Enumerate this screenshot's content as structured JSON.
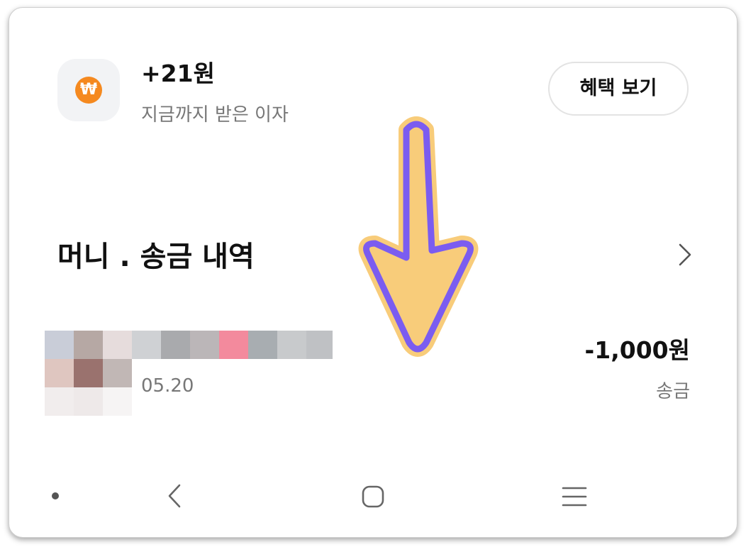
{
  "interest": {
    "amount": "+21원",
    "label": "지금까지 받은 이자",
    "icon": "won-coin-icon",
    "coin_symbol": "₩",
    "coin_color": "#f5891f"
  },
  "benefit_button": {
    "label": "혜택 보기"
  },
  "history_section": {
    "title": "머니 . 송금 내역",
    "chevron_icon": "chevron-right-icon"
  },
  "transaction": {
    "date": "05.20",
    "amount": "-1,000원",
    "type": "송금"
  },
  "annotation": {
    "icon": "arrow-down-icon",
    "fill_color": "#f8cc7a",
    "stroke_color": "#7b5cf0"
  },
  "nav_bar": {
    "icons": [
      "dot-icon",
      "back-icon",
      "home-icon",
      "recents-icon"
    ]
  }
}
